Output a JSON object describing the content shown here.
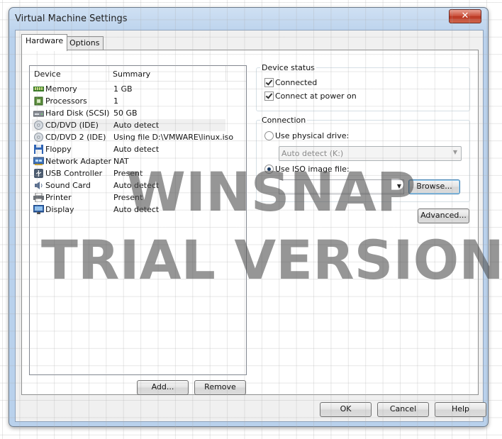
{
  "window": {
    "title": "Virtual Machine Settings",
    "close_glyph": "✕"
  },
  "tabs": [
    {
      "label": "Hardware",
      "active": true
    },
    {
      "label": "Options",
      "active": false
    }
  ],
  "device_list": {
    "headers": {
      "device": "Device",
      "summary": "Summary"
    },
    "rows": [
      {
        "name": "Memory",
        "summary": "1 GB",
        "icon": "memory-icon"
      },
      {
        "name": "Processors",
        "summary": "1",
        "icon": "processor-icon"
      },
      {
        "name": "Hard Disk (SCSI)",
        "summary": "50 GB",
        "icon": "hard-disk-icon"
      },
      {
        "name": "CD/DVD (IDE)",
        "summary": "Auto detect",
        "icon": "cd-dvd-icon",
        "selected": true
      },
      {
        "name": "CD/DVD 2 (IDE)",
        "summary": "Using file D:\\VMWARE\\linux.iso",
        "icon": "cd-dvd-icon"
      },
      {
        "name": "Floppy",
        "summary": "Auto detect",
        "icon": "floppy-icon"
      },
      {
        "name": "Network Adapter",
        "summary": "NAT",
        "icon": "network-adapter-icon"
      },
      {
        "name": "USB Controller",
        "summary": "Present",
        "icon": "usb-icon"
      },
      {
        "name": "Sound Card",
        "summary": "Auto detect",
        "icon": "sound-card-icon"
      },
      {
        "name": "Printer",
        "summary": "Present",
        "icon": "printer-icon"
      },
      {
        "name": "Display",
        "summary": "Auto detect",
        "icon": "display-icon"
      }
    ]
  },
  "buttons": {
    "add": "Add...",
    "remove": "Remove",
    "browse": "Browse...",
    "advanced": "Advanced...",
    "ok": "OK",
    "cancel": "Cancel",
    "help": "Help"
  },
  "device_status": {
    "title": "Device status",
    "connected": {
      "label": "Connected",
      "checked": true
    },
    "connect_at_power_on": {
      "label": "Connect at power on",
      "checked": true
    }
  },
  "connection": {
    "title": "Connection",
    "physical_drive": {
      "label": "Use physical drive:",
      "selected": false,
      "value": "Auto detect (K:)"
    },
    "iso_image": {
      "label": "Use ISO image file:",
      "selected": true,
      "value": ""
    }
  },
  "watermark": {
    "line1": "WINSNAP",
    "line2": "TRIAL VERSION"
  },
  "colors": {
    "titlebar": "#b9d1ec",
    "close_button": "#c94b35",
    "focus_border": "#3c7fb1"
  }
}
